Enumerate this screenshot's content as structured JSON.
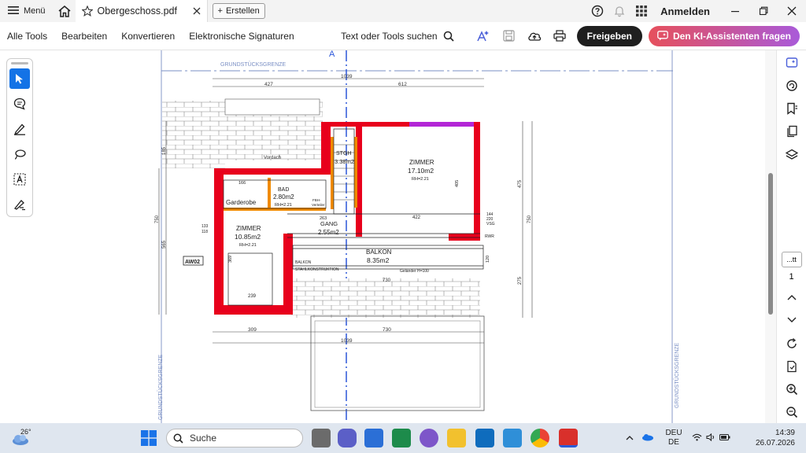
{
  "topbar": {
    "menu_label": "Menü",
    "tab_title": "Obergeschoss.pdf",
    "new_tab_label": "Erstellen",
    "signin_label": "Anmelden"
  },
  "toolbar": {
    "all_tools": "Alle Tools",
    "edit": "Bearbeiten",
    "convert": "Konvertieren",
    "esign": "Elektronische Signaturen",
    "search_placeholder": "Text oder Tools suchen",
    "share_label": "Freigeben",
    "ai_label": "Den KI-Assistenten fragen",
    "ai_color_start": "#e6505c",
    "ai_color_end": "#a95ad9"
  },
  "left_tools": [
    "select-icon",
    "comment-icon",
    "pen-icon",
    "lasso-icon",
    "text-select-icon",
    "stamp-icon"
  ],
  "right_rail": {
    "icons": [
      "ai-chat-icon",
      "comments-icon",
      "bookmark-icon",
      "pages-icon",
      "layers-icon"
    ],
    "page_box": "...tt",
    "page_number": "1"
  },
  "drawing": {
    "boundary_top": "GRUNDSTÜCKSGRENZE",
    "boundary_side": "GRUNDSTÜCKSGRENZE",
    "axis_label": "A",
    "dim_total_top": "1039",
    "dim_left_top": "427",
    "dim_right_top": "612",
    "dim_total_bottom": "1039",
    "dim_bottom_left": "309",
    "dim_bottom_right": "730",
    "dim_balcony": "730",
    "dim_left_750": "750",
    "dim_left_565": "565",
    "dim_left_185": "185",
    "dim_right_475": "475",
    "dim_right_750": "750",
    "dim_right_275": "275",
    "rooms": {
      "zimmer_big": {
        "name": "ZIMMER",
        "area": "17.10m2",
        "rh": "RH=2.21"
      },
      "zimmer_small": {
        "name": "ZIMMER",
        "area": "10.85m2",
        "rh": "RH=2.21"
      },
      "bad": {
        "name": "BAD",
        "area": "2.80m2",
        "rh": "RH=2.21"
      },
      "gang": {
        "name": "GANG",
        "area": "2.55m2"
      },
      "stgh": {
        "name": "STGH",
        "area": "3.38m2"
      },
      "balkon": {
        "name": "BALKON",
        "area": "8.35m2"
      },
      "garderobe": "Garderobe"
    },
    "labels": {
      "vordach": "Vordach",
      "aw02": "AW02",
      "balkon_small": "BALKON",
      "stahlkonstruktion": "STAHLKONSTRUKTION",
      "gelaender": "Geländer H=100",
      "fbh": "FBH-",
      "verteiler": "Verteiler",
      "rwr": "RWR",
      "vsg": "VSG",
      "d166": "166",
      "d422": "422",
      "d239": "239",
      "d263": "263",
      "d133": "133",
      "d118": "118",
      "d369": "369",
      "d405": "405",
      "d120": "120",
      "d144": "144",
      "d220": "220"
    }
  },
  "taskbar": {
    "temperature": "26°",
    "search_label": "Suche",
    "lang_top": "DEU",
    "lang_bottom": "DE",
    "time": "14:39",
    "date": "26.07.2026"
  }
}
